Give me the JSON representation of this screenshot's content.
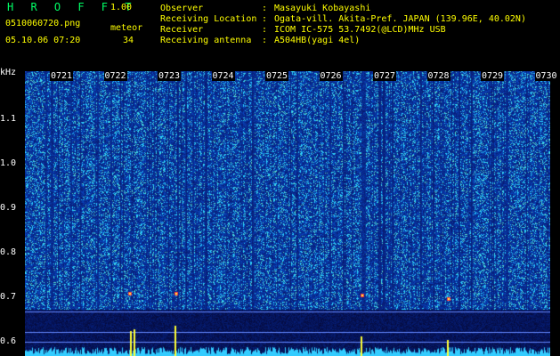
{
  "header": {
    "logo": "H R O F F T",
    "version": "1.00",
    "filename": "0510060720.png",
    "meteor_label": "meteor",
    "datetime": "05.10.06 07:20",
    "meteor_count": "34"
  },
  "info": [
    {
      "key": "Observer",
      "value": "Masayuki Kobayashi"
    },
    {
      "key": "Receiving Location",
      "value": "Ogata-vill. Akita-Pref. JAPAN (139.96E, 40.02N)"
    },
    {
      "key": "Receiver",
      "value": "ICOM IC-575 53.7492(@LCD)MHz USB"
    },
    {
      "key": "Receiving antenna",
      "value": "A504HB(yagi 4el)"
    }
  ],
  "axis": {
    "y_unit": "kHz",
    "y_ticks": [
      "1.1",
      "1.0",
      "0.9",
      "0.8",
      "0.7",
      "0.6"
    ],
    "x_ticks": [
      "0721",
      "0722",
      "0723",
      "0724",
      "0725",
      "0726",
      "0727",
      "0728",
      "0729",
      "0730"
    ]
  },
  "colors": {
    "background": "#000000",
    "text_yellow": "#ffff00",
    "logo_green": "#00ff66",
    "spectrum_base": "#0a1f7a",
    "spectrum_noise": "#2a6cff",
    "meteor_yellow": "#ffff33",
    "baseline_cyan": "#33ccff"
  }
}
